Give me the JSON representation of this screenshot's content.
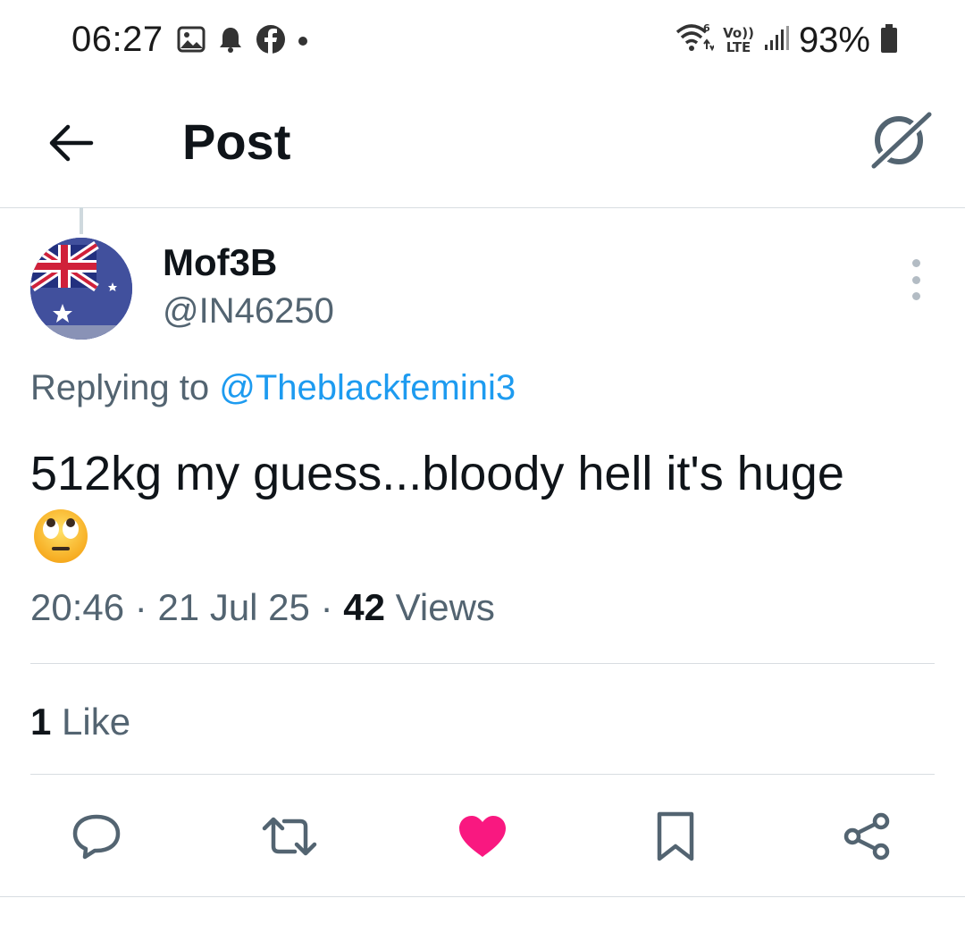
{
  "status_bar": {
    "time": "06:27",
    "battery": "93%",
    "left_icons": [
      "image-icon",
      "bell-icon",
      "facebook-icon",
      "dot-icon"
    ],
    "right_icons": [
      "wifi-6-icon",
      "volte-icon",
      "signal-icon",
      "battery-icon"
    ],
    "network_label": "LTE",
    "volte_label": "Vo))"
  },
  "header": {
    "title": "Post",
    "back_icon": "arrow-left-icon",
    "right_icon": "grok-icon"
  },
  "post": {
    "display_name": "Mof3B",
    "handle": "@IN46250",
    "avatar": "australian-flag-avatar",
    "replying_prefix": "Replying to ",
    "replying_handle": "@Theblackfemini3",
    "text": "512kg my guess...bloody hell it's huge",
    "emoji": "face-with-rolling-eyes",
    "time": "20:46",
    "date": "21 Jul 25",
    "separator": " · ",
    "views_count": "42",
    "views_label": " Views",
    "likes_count": "1",
    "likes_label": " Like"
  },
  "actions": [
    {
      "name": "reply",
      "icon": "reply-icon"
    },
    {
      "name": "repost",
      "icon": "repost-icon"
    },
    {
      "name": "like",
      "icon": "heart-icon",
      "active": true
    },
    {
      "name": "bookmark",
      "icon": "bookmark-icon"
    },
    {
      "name": "share",
      "icon": "share-icon"
    }
  ],
  "colors": {
    "accent": "#1d9bf0",
    "like": "#f91880",
    "text_primary": "#0f1419",
    "text_secondary": "#536471"
  }
}
